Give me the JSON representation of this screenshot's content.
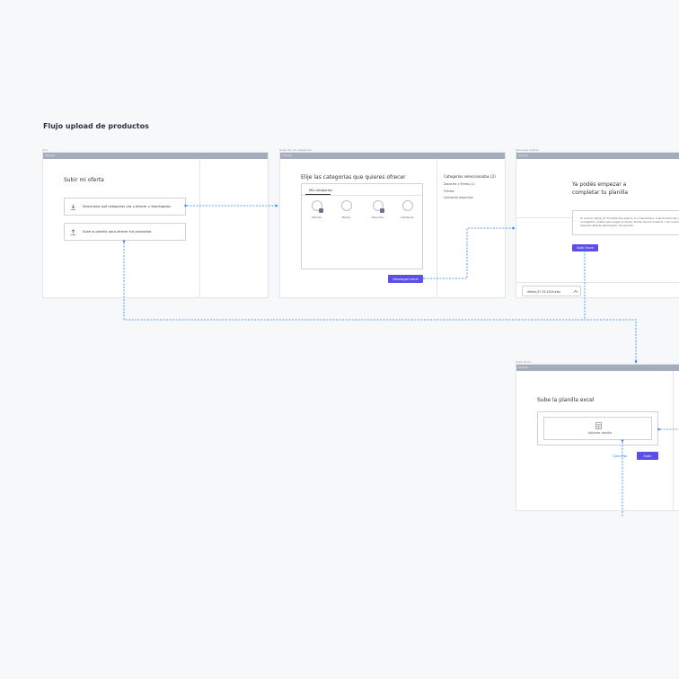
{
  "page": {
    "title": "Flujo upload de productos"
  },
  "frame1": {
    "label": "Hub",
    "bar_text": "Ofertas",
    "heading": "Subir mi oferta",
    "step1": "Selecciona qué categorías vas a ofrecer y descárgalas",
    "step2": "Sube la planilla para ofrecer tus productos"
  },
  "frame2": {
    "label": "Selección de categorías",
    "bar_text": "Ofertas",
    "heading": "Elije las categorías que quieres ofrecer",
    "tab": "Mis categorías",
    "categories": [
      "Ofertas",
      "Bebés",
      "Deportes",
      "Cafeteras"
    ],
    "side_title": "Categorías seleccionadas (2)",
    "side_items": [
      "Deportes y fitness (2)",
      "Ofertas",
      "Contenido deportivo"
    ],
    "button": "Descargar excel"
  },
  "frame3": {
    "label": "Descarga exitosa",
    "bar_text": "Ofertas",
    "heading_line1": "Ya podés empezar a",
    "heading_line2": "completar tu planilla",
    "note": "Tu archivo oferta_07-15-2019.xlsx está en tu computadora. Cuando termines de completarlo, súbelo para cargar tu oferta. Podrás hacerlo hasta el 7 de noviembre; después deberás descargarlo otra planilla.",
    "button": "Subir Excel",
    "download_file": "oferta_07-15-2019.xlsx"
  },
  "frame4": {
    "label": "Subir Excel",
    "bar_text": "Ofertas",
    "heading": "Sube la planilla excel",
    "dropzone": "Adjuntar planilla",
    "cancel": "Cancelar",
    "submit": "Subir"
  },
  "colors": {
    "accent": "#5c4ee6",
    "connector": "#2f80ed",
    "bar": "#a3adbc"
  }
}
